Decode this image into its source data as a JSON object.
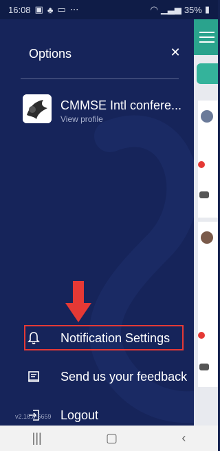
{
  "status_bar": {
    "time": "16:08",
    "battery": "35%"
  },
  "drawer": {
    "title": "Options",
    "profile": {
      "name": "CMMSE Intl confere...",
      "subtitle": "View profile"
    },
    "items": [
      {
        "label": "Notification Settings",
        "icon": "bell-icon"
      },
      {
        "label": "Send us your feedback",
        "icon": "feedback-icon"
      },
      {
        "label": "Logout",
        "icon": "logout-icon"
      }
    ],
    "version": "v2.16.8-5659"
  },
  "colors": {
    "drawer_bg": "#16245a",
    "highlight": "#e53935",
    "accent": "#2aa38d"
  }
}
